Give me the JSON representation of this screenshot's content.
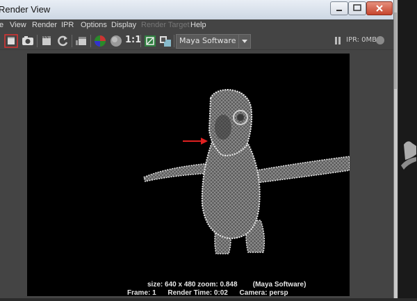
{
  "window": {
    "title": "Render View"
  },
  "menu": [
    "View",
    "Render",
    "IPR",
    "Options",
    "Display",
    "Render Target",
    "Help"
  ],
  "toolbar": {
    "zoom_ratio": "1:1",
    "renderer": "Maya Software",
    "ipr_status": "IPR: 0MB"
  },
  "render_info": {
    "line1": "size: 640 x 480 zoom: 0.848        (Maya Software)",
    "frame": "Frame: 1",
    "render_time": "Render Time: 0:02",
    "camera": "Camera: persp"
  },
  "colors": {
    "canvas_bg": "#000000",
    "annotation_arrow": "#e02020",
    "title_gradient_top": "#e9eef5",
    "close_button": "#c5452e"
  }
}
